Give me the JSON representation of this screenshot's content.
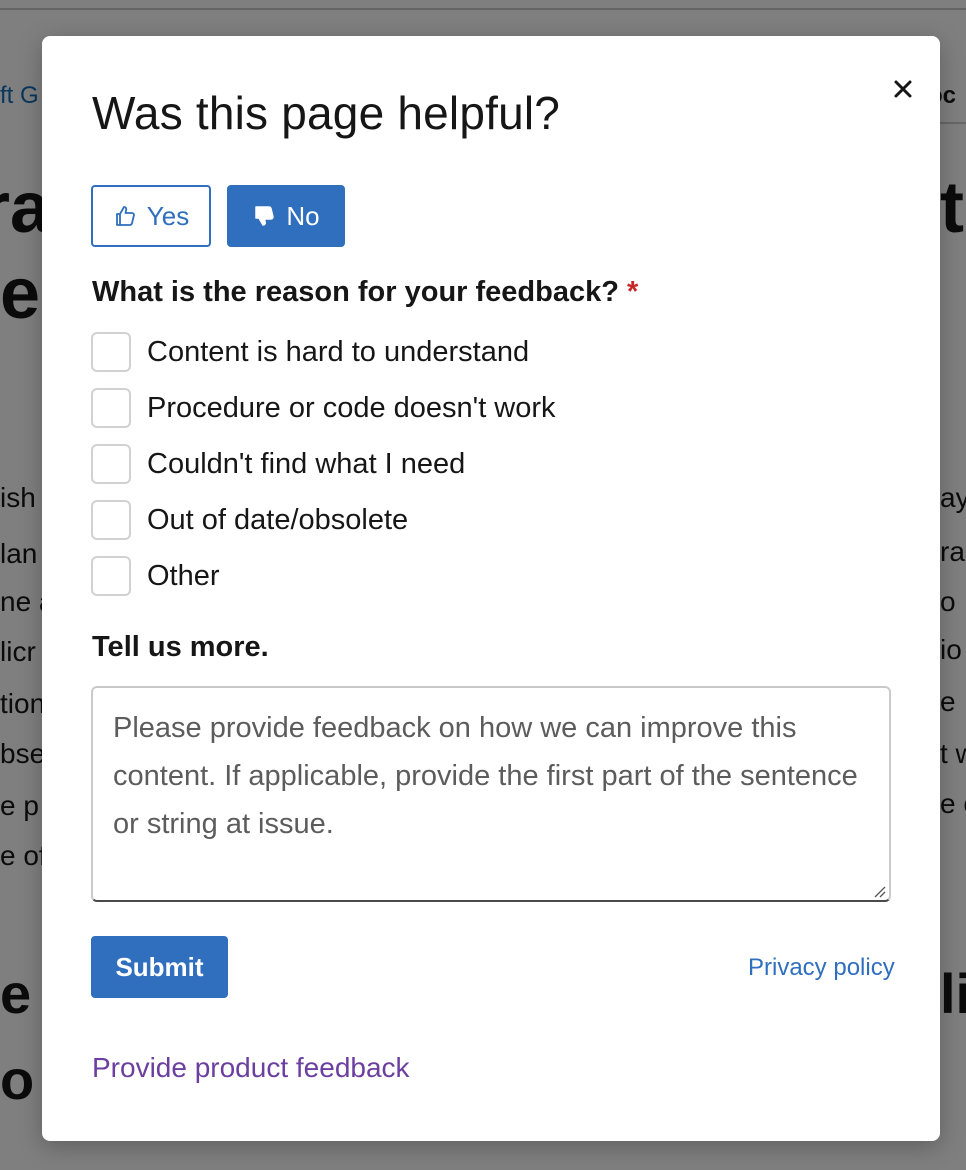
{
  "background": {
    "crumb_left": "ft G",
    "crumb_right": "oc",
    "heading_left_1": "ra",
    "heading_left_2": "e",
    "heading_right_1": "t",
    "body_left": [
      "ish",
      "lan",
      "ne a",
      "licr",
      "tion",
      "bse",
      "e p",
      "e of"
    ],
    "body_right": [
      "ay",
      "ra",
      "o",
      "io",
      "e",
      "t w",
      "e c"
    ],
    "heading2_left_1": "e",
    "heading2_left_2": "o",
    "heading2_right": "li"
  },
  "dialog": {
    "title": "Was this page helpful?",
    "close_label": "×",
    "yes_label": "Yes",
    "no_label": "No",
    "selected_vote": "No",
    "reason_question": "What is the reason for your feedback?",
    "required_marker": "*",
    "reasons": [
      {
        "label": "Content is hard to understand",
        "checked": false
      },
      {
        "label": "Procedure or code doesn't work",
        "checked": false
      },
      {
        "label": "Couldn't find what I need",
        "checked": false
      },
      {
        "label": "Out of date/obsolete",
        "checked": false
      },
      {
        "label": "Other",
        "checked": false
      }
    ],
    "tell_more_label": "Tell us more.",
    "feedback_placeholder": "Please provide feedback on how we can improve this content. If applicable, provide the first part of the sentence or string at issue.",
    "feedback_value": "",
    "submit_label": "Submit",
    "privacy_label": "Privacy policy",
    "product_feedback_label": "Provide product feedback"
  },
  "colors": {
    "accent": "#2f6fbe",
    "visited_link": "#6b3fa0",
    "required": "#c62828",
    "overlay": "rgba(0,0,0,0.5)"
  }
}
